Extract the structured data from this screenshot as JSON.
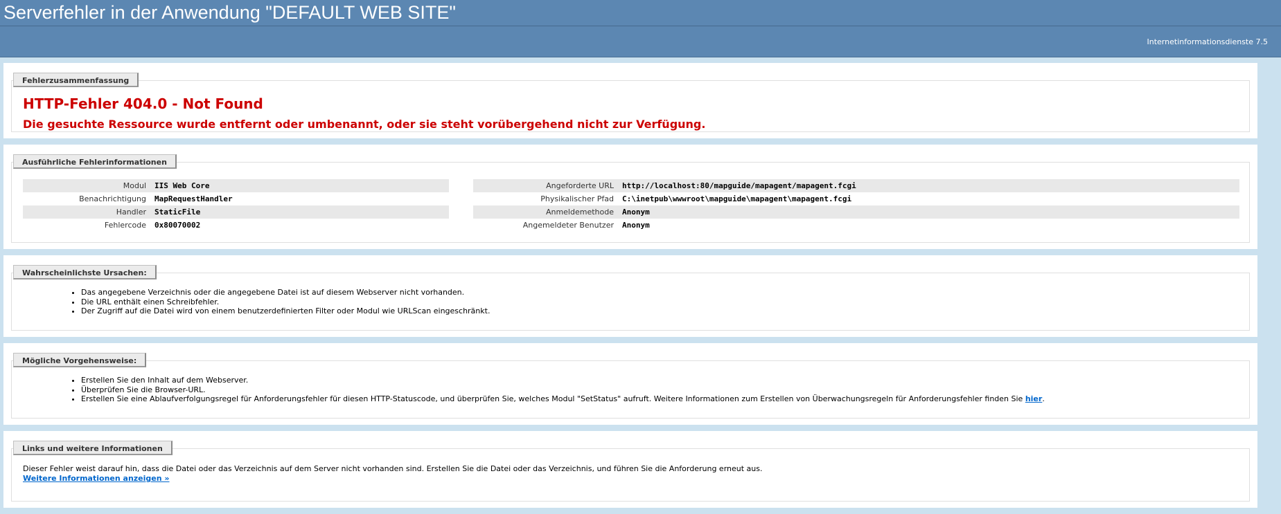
{
  "header": {
    "title": "Serverfehler in der Anwendung \"DEFAULT WEB SITE\"",
    "version": "Internetinformationsdienste 7.5"
  },
  "summary": {
    "legend": "Fehlerzusammenfassung",
    "error_title": "HTTP-Fehler 404.0 - Not Found",
    "error_message": "Die gesuchte Ressource wurde entfernt oder umbenannt, oder sie steht vorübergehend nicht zur Verfügung."
  },
  "details": {
    "legend": "Ausführliche Fehlerinformationen",
    "left": [
      {
        "label": "Modul",
        "value": "IIS Web Core"
      },
      {
        "label": "Benachrichtigung",
        "value": "MapRequestHandler"
      },
      {
        "label": "Handler",
        "value": "StaticFile"
      },
      {
        "label": "Fehlercode",
        "value": "0x80070002"
      }
    ],
    "right": [
      {
        "label": "Angeforderte URL",
        "value": "http://localhost:80/mapguide/mapagent/mapagent.fcgi"
      },
      {
        "label": "Physikalischer Pfad",
        "value": "C:\\inetpub\\wwwroot\\mapguide\\mapagent\\mapagent.fcgi"
      },
      {
        "label": "Anmeldemethode",
        "value": "Anonym"
      },
      {
        "label": "Angemeldeter Benutzer",
        "value": "Anonym"
      }
    ]
  },
  "causes": {
    "legend": "Wahrscheinlichste Ursachen:",
    "items": [
      "Das angegebene Verzeichnis oder die angegebene Datei ist auf diesem Webserver nicht vorhanden.",
      "Die URL enthält einen Schreibfehler.",
      "Der Zugriff auf die Datei wird von einem benutzerdefinierten Filter oder Modul wie URLScan eingeschränkt."
    ]
  },
  "actions": {
    "legend": "Mögliche Vorgehensweise:",
    "items": [
      "Erstellen Sie den Inhalt auf dem Webserver.",
      "Überprüfen Sie die Browser-URL."
    ],
    "item3_text": "Erstellen Sie eine Ablaufverfolgungsregel für Anforderungsfehler für diesen HTTP-Statuscode, und überprüfen Sie, welches Modul \"SetStatus\" aufruft. Weitere Informationen zum Erstellen von Überwachungsregeln für Anforderungsfehler finden Sie ",
    "item3_link": "hier",
    "item3_suffix": "."
  },
  "links": {
    "legend": "Links und weitere Informationen",
    "description": "Dieser Fehler weist darauf hin, dass die Datei oder das Verzeichnis auf dem Server nicht vorhanden sind. Erstellen Sie die Datei oder das Verzeichnis, und führen Sie die Anforderung erneut aus.",
    "more_link": "Weitere Informationen anzeigen »"
  }
}
